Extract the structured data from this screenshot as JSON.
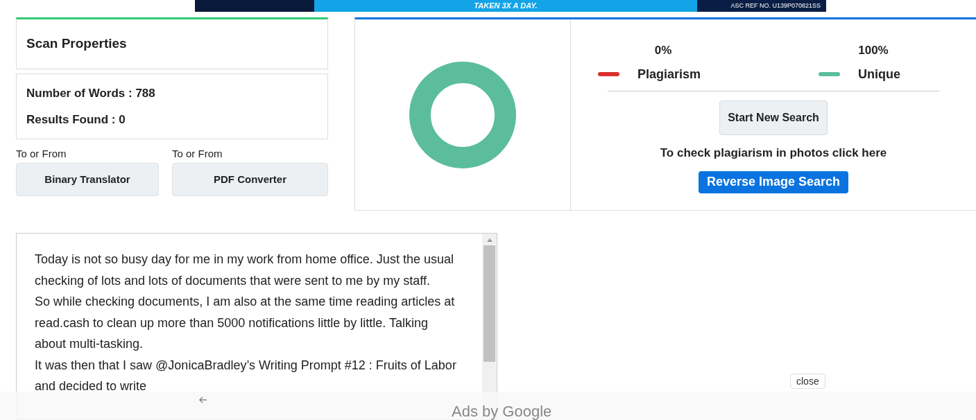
{
  "ad_banner": {
    "tagline": "TAKEN 3X A DAY.",
    "reference": "ASC REF NO. U139P070821SS"
  },
  "scan_properties": {
    "title": "Scan Properties",
    "words": "Number of Words : 788",
    "results": "Results Found : 0"
  },
  "tools": [
    {
      "label": "To or From",
      "button": "Binary Translator"
    },
    {
      "label": "To or From",
      "button": "PDF Converter"
    }
  ],
  "result": {
    "legend": [
      {
        "percent": "0%",
        "label": "Plagiarism",
        "color": "#dc2f2f"
      },
      {
        "percent": "100%",
        "label": "Unique",
        "color": "#5bbd9b"
      }
    ],
    "start_button": "Start New Search",
    "photo_hint": "To check plagiarism in photos click here",
    "reverse_button": "Reverse Image Search"
  },
  "document": {
    "paragraphs": [
      "Today is not so busy day for me in my work from home office. Just the usual checking of lots and lots of documents that were sent to me by my staff.",
      "So while checking documents, I am also at the same time reading articles at read.cash to clean up more than 5000 notifications little by little. Talking about multi-tasking.",
      "It was then that I saw @JonicaBradley’s Writing Prompt #12 : Fruits of Labor and decided to write"
    ]
  },
  "ad_overlay": {
    "close": "close",
    "attribution": "Ads by Google"
  }
}
